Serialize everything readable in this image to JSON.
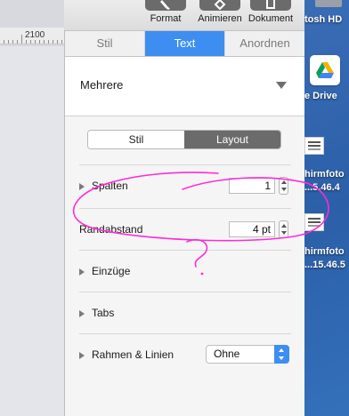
{
  "ruler": {
    "label": "2100"
  },
  "toolbar": {
    "items": [
      {
        "label": "Format",
        "icon": "paintbrush-icon"
      },
      {
        "label": "Animieren",
        "icon": "diamond-icon"
      },
      {
        "label": "Dokument",
        "icon": "document-icon"
      }
    ]
  },
  "desktop": {
    "disk_label": "tosh HD",
    "drive_label": "e Drive",
    "shot1_line1": "hirmfoto",
    "shot1_line2": "...5.46.4",
    "shot2_line1": "hirmfoto",
    "shot2_line2": "...15.46.5"
  },
  "inspector": {
    "tabs": [
      {
        "label": "Stil",
        "active": false
      },
      {
        "label": "Text",
        "active": true
      },
      {
        "label": "Anordnen",
        "active": false
      }
    ],
    "paragraph_style": "Mehrere",
    "segments": [
      {
        "label": "Stil",
        "selected": false
      },
      {
        "label": "Layout",
        "selected": true
      }
    ],
    "columns_label": "Spalten",
    "columns_value": "1",
    "inset_label": "Randabstand",
    "inset_value": "4 pt",
    "indents_label": "Einzüge",
    "tabs_label": "Tabs",
    "borders_label": "Rahmen & Linien",
    "borders_value": "Ohne"
  },
  "colors": {
    "accent": "#3d8ef0",
    "annotation": "#ff2bd6",
    "desktop": "#3368b4"
  }
}
